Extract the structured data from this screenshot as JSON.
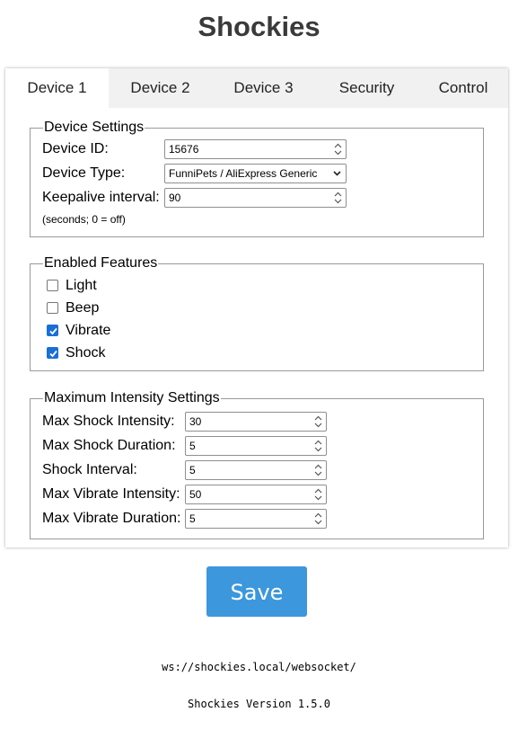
{
  "app_title": "Shockies",
  "tabs": [
    "Device 1",
    "Device 2",
    "Device 3",
    "Security",
    "Control"
  ],
  "device_settings": {
    "legend": "Device Settings",
    "device_id_label": "Device ID:",
    "device_id_value": "15676",
    "device_type_label": "Device Type:",
    "device_type_value": "FunniPets / AliExpress Generic",
    "keepalive_label": "Keepalive interval:",
    "keepalive_value": "90",
    "keepalive_note": "(seconds; 0 = off)"
  },
  "features": {
    "legend": "Enabled Features",
    "items": [
      {
        "label": "Light",
        "checked": false
      },
      {
        "label": "Beep",
        "checked": false
      },
      {
        "label": "Vibrate",
        "checked": true
      },
      {
        "label": "Shock",
        "checked": true
      }
    ]
  },
  "intensity": {
    "legend": "Maximum Intensity Settings",
    "fields": [
      {
        "label": "Max Shock Intensity:",
        "value": "30"
      },
      {
        "label": "Max Shock Duration:",
        "value": "5"
      },
      {
        "label": "Shock Interval:",
        "value": "5"
      },
      {
        "label": "Max Vibrate Intensity:",
        "value": "50"
      },
      {
        "label": "Max Vibrate Duration:",
        "value": "5"
      }
    ]
  },
  "save_label": "Save",
  "websocket_url": "ws://shockies.local/websocket/",
  "version_text": "Shockies Version 1.5.0",
  "colors": {
    "accent": "#3c97dc",
    "checkbox": "#1a6fd6",
    "tab_bar": "#f1f1f1"
  }
}
